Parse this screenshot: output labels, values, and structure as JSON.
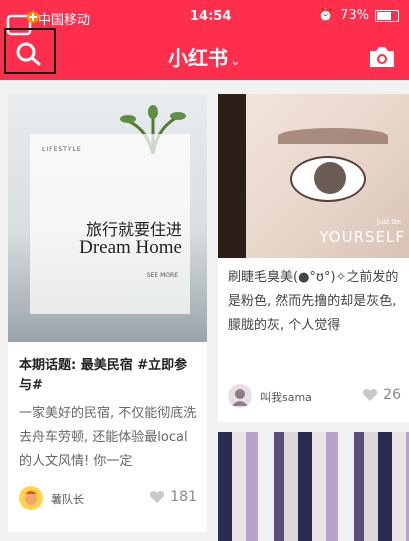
{
  "status_bar": {
    "carrier": "中国移动",
    "time": "14:54",
    "battery": "73%"
  },
  "nav": {
    "title": "小红书",
    "title_chevron": "⌄"
  },
  "feed": [
    {
      "poster": {
        "tag": "LIFESTYLE",
        "title_cn": "旅行就要住进",
        "title_en": "Dream Home",
        "more": "SEE MORE"
      },
      "title": "本期话题: 最美民宿 #立即参与#",
      "desc": "一家美好的民宿, 不仅能彻底洗去舟车劳顿, 还能体验最local的人文风情! 你一定",
      "author": "薯队长",
      "likes": "181"
    },
    {
      "poster": {
        "tag": "Just Be",
        "title_en": "YOURSELF"
      },
      "desc": "刷睫毛臭美(●°ʊ°)✧之前发的是粉色, 然而先撸的却是灰色, 朦胧的灰, 个人觉得",
      "author": "叫我sama",
      "likes": "26"
    }
  ],
  "colors": {
    "brand": "#ff2e4d"
  },
  "icons": [
    "search-icon",
    "camera-icon",
    "heart-icon",
    "wifi-icon",
    "alarm-icon"
  ]
}
